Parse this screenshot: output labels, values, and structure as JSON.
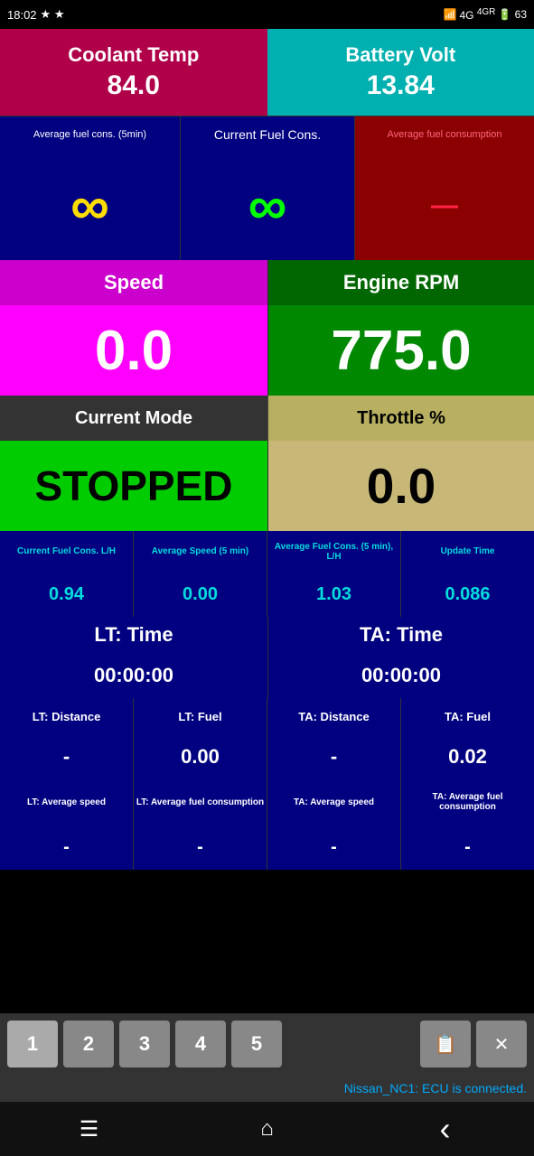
{
  "statusBar": {
    "time": "18:02",
    "rightIcons": "🔔 🎵 📶 4G 4GR 63"
  },
  "row1": {
    "coolantLabel": "Coolant Temp",
    "coolantValue": "84.0",
    "batteryLabel": "Battery Volt",
    "batteryValue": "13.84"
  },
  "row2": {
    "avgFuelHeader": "Average fuel cons. (5min)",
    "currentFuelHeader": "Current Fuel Cons.",
    "avgFuelConsHeader": "Average fuel consumption"
  },
  "row4": {
    "speedLabel": "Speed",
    "rpmLabel": "Engine RPM"
  },
  "row5": {
    "speedValue": "0.0",
    "rpmValue": "775.0"
  },
  "row6": {
    "modeLabel": "Current Mode",
    "throttleLabel": "Throttle %"
  },
  "row7": {
    "modeValue": "STOPPED",
    "throttleValue": "0.0"
  },
  "statsHeaders": {
    "h1": "Current Fuel Cons. L/H",
    "h2": "Average Speed (5 min)",
    "h3": "Average Fuel Cons. (5 min), L/H",
    "h4": "Update Time"
  },
  "statsValues": {
    "v1": "0.94",
    "v2": "0.00",
    "v3": "1.03",
    "v4": "0.086"
  },
  "ltTime": {
    "label": "LT: Time",
    "value": "00:00:00"
  },
  "taTime": {
    "label": "TA: Time",
    "value": "00:00:00"
  },
  "distFuelHeaders": {
    "ltDist": "LT: Distance",
    "ltFuel": "LT: Fuel",
    "taDist": "TA: Distance",
    "taFuel": "TA: Fuel"
  },
  "distFuelValues": {
    "ltDist": "-",
    "ltFuel": "0.00",
    "taDist": "-",
    "taFuel": "0.02"
  },
  "avgHeaders": {
    "ltAvgSpeed": "LT: Average speed",
    "ltAvgFuel": "LT: Average fuel consumption",
    "taAvgSpeed": "TA: Average speed",
    "taAvgFuel": "TA: Average fuel consumption"
  },
  "avgValues": {
    "ltAvgSpeed": "-",
    "ltAvgFuel": "-",
    "taAvgSpeed": "-",
    "taAvgFuel": "-"
  },
  "navButtons": {
    "b1": "1",
    "b2": "2",
    "b3": "3",
    "b4": "4",
    "b5": "5"
  },
  "statusMsg": "Nissan_NC1: ECU is connected.",
  "systemNav": {
    "menu": "☰",
    "home": "⌂",
    "back": "‹"
  }
}
